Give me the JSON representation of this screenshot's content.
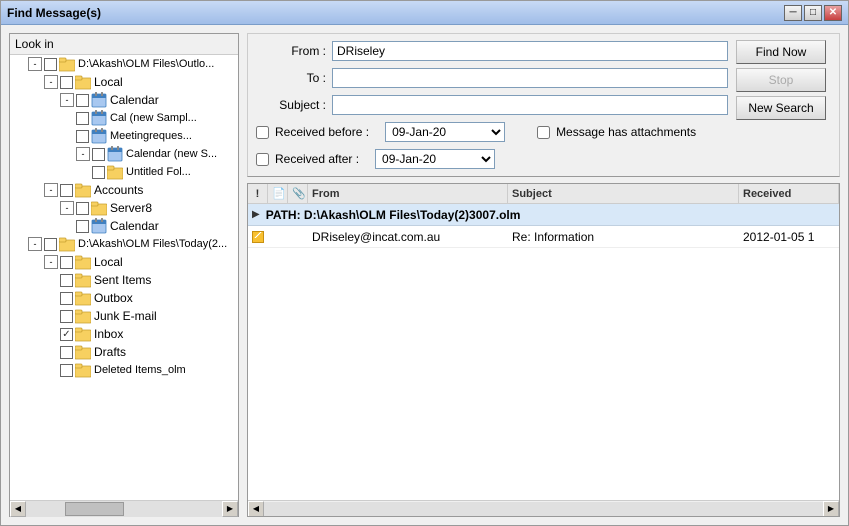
{
  "window": {
    "title": "Find Message(s)"
  },
  "lookIn": {
    "label": "Look in"
  },
  "tree": {
    "items": [
      {
        "id": "root",
        "label": "D:\\Akash\\OLM Files\\Outlo...",
        "indent": 0,
        "expanded": true,
        "hasExpander": true,
        "icon": "folder",
        "checked": false
      },
      {
        "id": "local1",
        "label": "Local",
        "indent": 1,
        "expanded": true,
        "hasExpander": true,
        "icon": "folder",
        "checked": false
      },
      {
        "id": "calendar",
        "label": "Calendar",
        "indent": 2,
        "expanded": true,
        "hasExpander": true,
        "icon": "calendar",
        "checked": false
      },
      {
        "id": "cal-new-sample",
        "label": "Cal (new Sampl...",
        "indent": 3,
        "hasExpander": false,
        "icon": "calendar",
        "checked": false
      },
      {
        "id": "meetingrequest",
        "label": "Meetingreques...",
        "indent": 3,
        "hasExpander": false,
        "icon": "calendar",
        "checked": false
      },
      {
        "id": "calendar-new",
        "label": "Calendar (new S...",
        "indent": 3,
        "expanded": true,
        "hasExpander": true,
        "icon": "calendar",
        "checked": false
      },
      {
        "id": "untitled-fol",
        "label": "Untitled Fol...",
        "indent": 4,
        "hasExpander": false,
        "icon": "folder",
        "checked": false
      },
      {
        "id": "accounts",
        "label": "Accounts",
        "indent": 1,
        "expanded": true,
        "hasExpander": true,
        "icon": "folder",
        "checked": false
      },
      {
        "id": "server8",
        "label": "Server8",
        "indent": 2,
        "expanded": true,
        "hasExpander": true,
        "icon": "folder",
        "checked": false
      },
      {
        "id": "calendar2",
        "label": "Calendar",
        "indent": 3,
        "hasExpander": false,
        "icon": "calendar",
        "checked": false
      },
      {
        "id": "root2",
        "label": "D:\\Akash\\OLM Files\\Today(2...",
        "indent": 0,
        "expanded": true,
        "hasExpander": true,
        "icon": "folder",
        "checked": false
      },
      {
        "id": "local2",
        "label": "Local",
        "indent": 1,
        "expanded": true,
        "hasExpander": true,
        "icon": "folder",
        "checked": false
      },
      {
        "id": "sent-items",
        "label": "Sent Items",
        "indent": 2,
        "hasExpander": false,
        "icon": "folder",
        "checked": false
      },
      {
        "id": "outbox",
        "label": "Outbox",
        "indent": 2,
        "hasExpander": false,
        "icon": "folder",
        "checked": false
      },
      {
        "id": "junk-email",
        "label": "Junk E-mail",
        "indent": 2,
        "hasExpander": false,
        "icon": "folder",
        "checked": false
      },
      {
        "id": "inbox",
        "label": "Inbox",
        "indent": 2,
        "hasExpander": false,
        "icon": "folder",
        "checked": true
      },
      {
        "id": "drafts",
        "label": "Drafts",
        "indent": 2,
        "hasExpander": false,
        "icon": "folder",
        "checked": false
      },
      {
        "id": "deleted",
        "label": "Deleted Items_olm",
        "indent": 2,
        "hasExpander": false,
        "icon": "folder-delete",
        "checked": false
      }
    ]
  },
  "form": {
    "from_label": "From :",
    "from_value": "DRiseley",
    "to_label": "To :",
    "to_value": "",
    "subject_label": "Subject :",
    "subject_value": "",
    "received_before_label": "Received before :",
    "received_before_value": "09-Jan-20",
    "received_after_label": "Received after :",
    "received_after_value": "09-Jan-20",
    "message_has_attachments_label": "Message has attachments"
  },
  "buttons": {
    "find_now": "Find Now",
    "stop": "Stop",
    "new_search": "New Search"
  },
  "results": {
    "columns": {
      "exclamation": "!",
      "doc": "📄",
      "attach": "📎",
      "from": "From",
      "subject": "Subject",
      "received": "Received"
    },
    "path_row": "PATH: D:\\Akash\\OLM Files\\Today(2)3007.olm",
    "rows": [
      {
        "from": "DRiseley@incat.com.au",
        "subject": "Re: Information",
        "received": "2012-01-05 1"
      }
    ]
  }
}
